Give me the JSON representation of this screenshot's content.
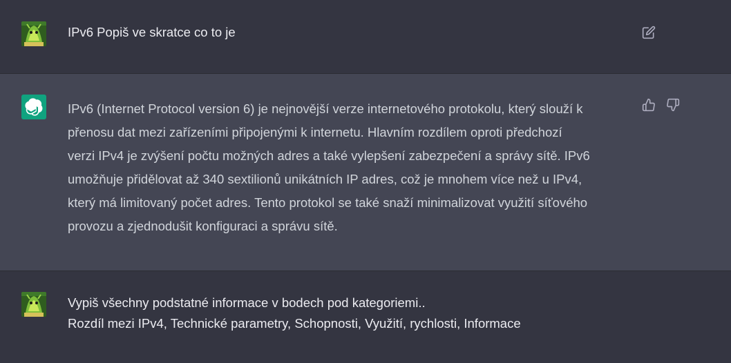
{
  "messages": [
    {
      "role": "user",
      "text": "IPv6 Popiš ve skratce co to je"
    },
    {
      "role": "assistant",
      "lines": [
        "IPv6 (Internet Protocol version 6) je nejnovější verze internetového protokolu, který slouží k",
        "přenosu dat mezi zařízeními připojenými k internetu. Hlavním rozdílem oproti předchozí",
        "verzi IPv4 je zvýšení počtu možných adres a také vylepšení zabezpečení a správy sítě. IPv6",
        "umožňuje přidělovat až 340 sextilionů unikátních IP adres, což je mnohem více než u IPv4,",
        "který má limitovaný počet adres. Tento protokol se také snaží minimalizovat využití síťového",
        "provozu a zjednodušit konfiguraci a správu sítě."
      ]
    },
    {
      "role": "user",
      "lines": [
        "Vypiš všechny podstatné informace v bodech pod kategoriemi..",
        "Rozdíl mezi IPv4, Technické parametry, Schopnosti, Využití, rychlosti, Informace"
      ]
    }
  ],
  "icons": {
    "edit": "edit-icon",
    "thumbs_up": "thumbs-up-icon",
    "thumbs_down": "thumbs-down-icon",
    "assistant_logo": "openai-logo-icon"
  },
  "colors": {
    "user_row_bg": "#343541",
    "assistant_row_bg": "#444654",
    "assistant_avatar_bg": "#10a37f",
    "text": "#d1d5db",
    "icon": "#acacbe"
  }
}
